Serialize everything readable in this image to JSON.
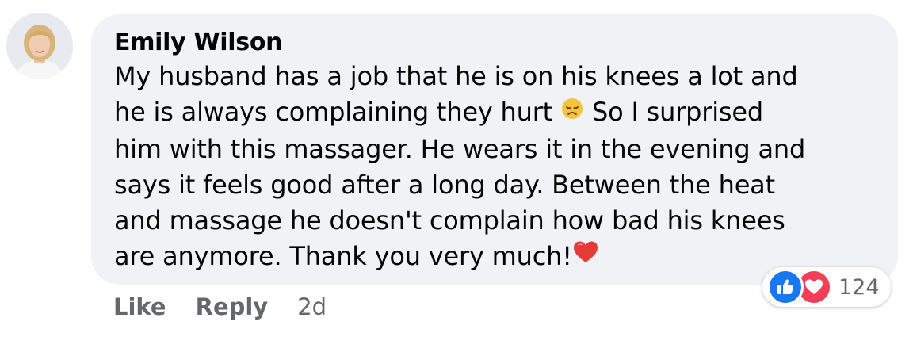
{
  "comment": {
    "author": "Emily Wilson",
    "lines": [
      "My husband has a job that he is on his knees a lot and",
      "he is always complaining they hurt",
      "So I surprised",
      "him with this massager. He wears it in the evening and",
      "says it feels good after a long day. Between the heat",
      "and massage he doesn't complain how bad his knees",
      "are anymore. Thank you very much!"
    ],
    "emoji_inline": "disappointed-face-icon",
    "emoji_end": "red-heart-icon"
  },
  "reactions": {
    "types": [
      "like",
      "love"
    ],
    "count": "124",
    "colors": {
      "like": "#1877f2",
      "love": "#f33e58"
    }
  },
  "actions": {
    "like_label": "Like",
    "reply_label": "Reply",
    "timestamp": "2d"
  },
  "colors": {
    "bubble_bg": "#f0f2f5",
    "secondary_text": "#65676b"
  }
}
